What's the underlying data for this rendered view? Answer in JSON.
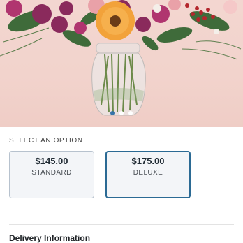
{
  "carousel": {
    "slide_count": 3,
    "active_index": 0,
    "accent_color": "#2f6fa6"
  },
  "options": {
    "section_label": "SELECT AN OPTION",
    "items": [
      {
        "price": "$145.00",
        "name": "STANDARD",
        "selected": false
      },
      {
        "price": "$175.00",
        "name": "DELUXE",
        "selected": true
      }
    ],
    "selected_border_color": "#2b6a94"
  },
  "delivery": {
    "heading": "Delivery Information"
  }
}
